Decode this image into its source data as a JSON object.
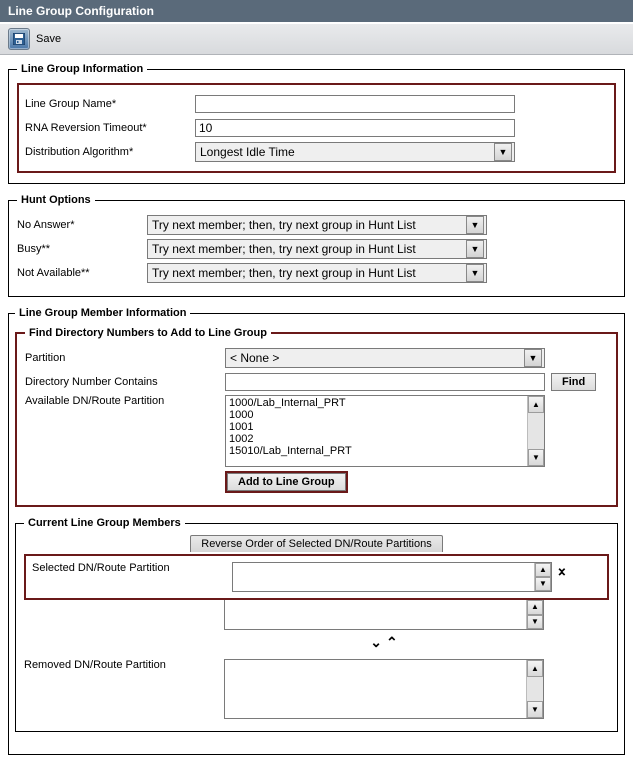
{
  "title": "Line Group Configuration",
  "toolbar": {
    "save_label": "Save"
  },
  "line_group_info": {
    "legend": "Line Group Information",
    "name_label": "Line Group Name",
    "name_value": "",
    "rna_label": "RNA Reversion Timeout",
    "rna_value": "10",
    "algo_label": "Distribution Algorithm",
    "algo_value": "Longest Idle Time"
  },
  "hunt": {
    "legend": "Hunt Options",
    "no_answer_label": "No Answer",
    "no_answer_value": "Try next member; then, try next group in Hunt List",
    "busy_label": "Busy",
    "busy_value": "Try next member; then, try next group in Hunt List",
    "not_avail_label": "Not Available",
    "not_avail_value": "Try next member; then, try next group in Hunt List"
  },
  "member_info": {
    "legend": "Line Group Member Information"
  },
  "find": {
    "legend": "Find Directory Numbers to Add to Line Group",
    "partition_label": "Partition",
    "partition_value": "< None >",
    "contains_label": "Directory Number Contains",
    "contains_value": "",
    "find_btn": "Find",
    "avail_label": "Available DN/Route Partition",
    "avail_list": [
      "1000/Lab_Internal_PRT",
      "1000",
      "1001",
      "1002",
      "15010/Lab_Internal_PRT"
    ],
    "add_btn": "Add to Line Group"
  },
  "current": {
    "legend": "Current Line Group Members",
    "reverse_btn": "Reverse Order of Selected DN/Route Partitions",
    "selected_label": "Selected DN/Route Partition",
    "removed_label": "Removed DN/Route Partition"
  }
}
